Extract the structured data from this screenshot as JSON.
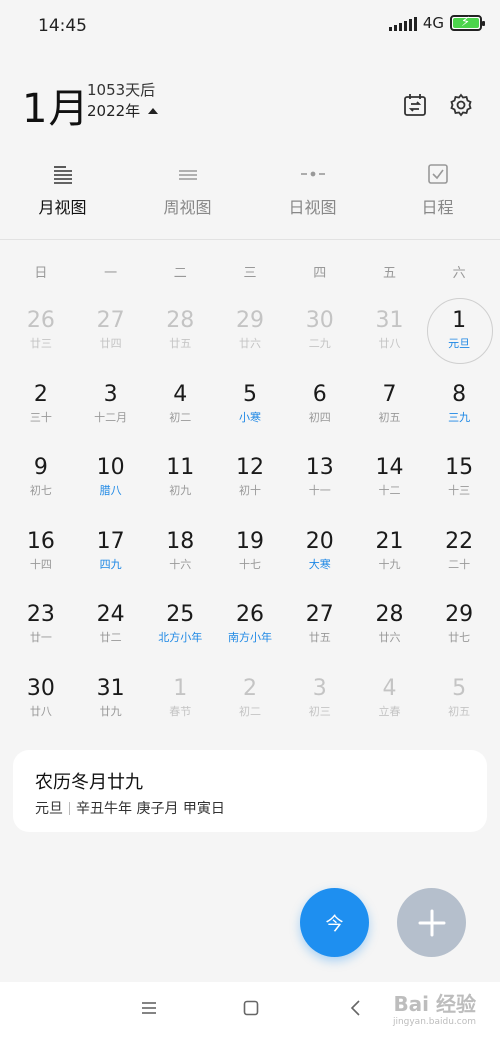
{
  "status_bar": {
    "time": "14:45",
    "network": "4G"
  },
  "header": {
    "month": "1月",
    "days_after": "1053天后",
    "year": "2022年"
  },
  "tabs": [
    {
      "label": "月视图",
      "icon": "month-view-icon",
      "active": true
    },
    {
      "label": "周视图",
      "icon": "week-view-icon",
      "active": false
    },
    {
      "label": "日视图",
      "icon": "day-view-icon",
      "active": false
    },
    {
      "label": "日程",
      "icon": "agenda-icon",
      "active": false
    }
  ],
  "weekdays": [
    "日",
    "一",
    "二",
    "三",
    "四",
    "五",
    "六"
  ],
  "weeks": [
    [
      {
        "num": "26",
        "lunar": "廿三",
        "muted": true
      },
      {
        "num": "27",
        "lunar": "廿四",
        "muted": true
      },
      {
        "num": "28",
        "lunar": "廿五",
        "muted": true
      },
      {
        "num": "29",
        "lunar": "廿六",
        "muted": true
      },
      {
        "num": "30",
        "lunar": "二九",
        "muted": true
      },
      {
        "num": "31",
        "lunar": "廿八",
        "muted": true
      },
      {
        "num": "1",
        "lunar": "元旦",
        "fest": true,
        "selected": true
      }
    ],
    [
      {
        "num": "2",
        "lunar": "三十"
      },
      {
        "num": "3",
        "lunar": "十二月"
      },
      {
        "num": "4",
        "lunar": "初二"
      },
      {
        "num": "5",
        "lunar": "小寒",
        "fest": true
      },
      {
        "num": "6",
        "lunar": "初四"
      },
      {
        "num": "7",
        "lunar": "初五"
      },
      {
        "num": "8",
        "lunar": "三九",
        "fest": true
      }
    ],
    [
      {
        "num": "9",
        "lunar": "初七"
      },
      {
        "num": "10",
        "lunar": "腊八",
        "fest": true
      },
      {
        "num": "11",
        "lunar": "初九"
      },
      {
        "num": "12",
        "lunar": "初十"
      },
      {
        "num": "13",
        "lunar": "十一"
      },
      {
        "num": "14",
        "lunar": "十二"
      },
      {
        "num": "15",
        "lunar": "十三"
      }
    ],
    [
      {
        "num": "16",
        "lunar": "十四"
      },
      {
        "num": "17",
        "lunar": "四九",
        "fest": true
      },
      {
        "num": "18",
        "lunar": "十六"
      },
      {
        "num": "19",
        "lunar": "十七"
      },
      {
        "num": "20",
        "lunar": "大寒",
        "fest": true
      },
      {
        "num": "21",
        "lunar": "十九"
      },
      {
        "num": "22",
        "lunar": "二十"
      }
    ],
    [
      {
        "num": "23",
        "lunar": "廿一"
      },
      {
        "num": "24",
        "lunar": "廿二"
      },
      {
        "num": "25",
        "lunar": "北方小年",
        "fest": true
      },
      {
        "num": "26",
        "lunar": "南方小年",
        "fest": true
      },
      {
        "num": "27",
        "lunar": "廿五"
      },
      {
        "num": "28",
        "lunar": "廿六"
      },
      {
        "num": "29",
        "lunar": "廿七"
      }
    ],
    [
      {
        "num": "30",
        "lunar": "廿八"
      },
      {
        "num": "31",
        "lunar": "廿九"
      },
      {
        "num": "1",
        "lunar": "春节",
        "muted": true
      },
      {
        "num": "2",
        "lunar": "初二",
        "muted": true
      },
      {
        "num": "3",
        "lunar": "初三",
        "muted": true
      },
      {
        "num": "4",
        "lunar": "立春",
        "muted": true
      },
      {
        "num": "5",
        "lunar": "初五",
        "muted": true
      }
    ]
  ],
  "info_card": {
    "title": "农历冬月廿九",
    "festival": "元旦",
    "ganzhi": "辛丑牛年 庚子月 甲寅日"
  },
  "fab": {
    "today_label": "今"
  },
  "watermark": {
    "main": "Bai 经验",
    "sub": "jingyan.baidu.com"
  },
  "colors": {
    "accent": "#1e8ff0",
    "festival_text": "#1e88e5",
    "add_button": "#b5bfcc"
  }
}
